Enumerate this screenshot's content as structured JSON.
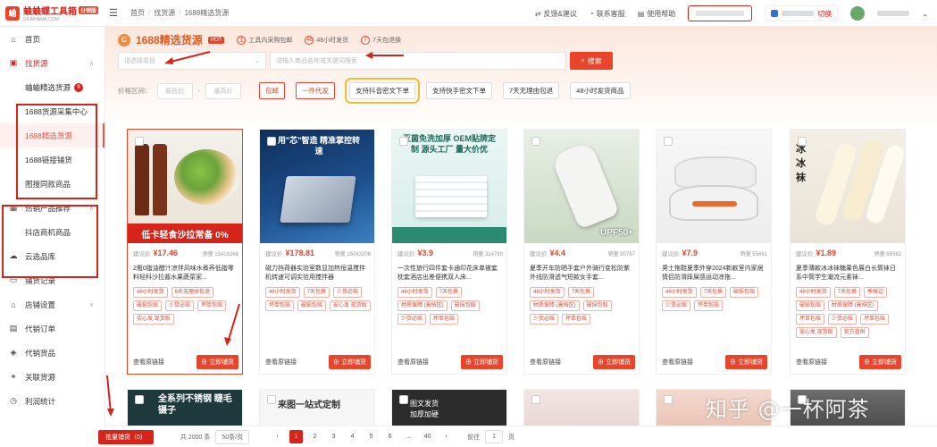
{
  "app": {
    "logo_name": "蛐蛐蝶工具箱",
    "logo_tag": "分销版",
    "logo_url": "SILAIHAMA.COM",
    "logo_badge": "蛐"
  },
  "breadcrumb": [
    "首页",
    "找货源",
    "1688精选货源"
  ],
  "topbar": {
    "feedback": "反馈&建议",
    "contact": "联系客服",
    "help": "使用帮助",
    "switch": "切换"
  },
  "sidebar": {
    "home": "首页",
    "find_source": "找货源",
    "sub_find": [
      "蛐蛐精选货源",
      "1688货源采集中心",
      "1688精选货源",
      "1688链接铺货",
      "图搜同款商品"
    ],
    "sub_find_badge": "9",
    "hot": "热销产品推荐",
    "sub_hot": [
      "抖店商机商品"
    ],
    "cloud": "云选品库",
    "items": [
      "铺货记录",
      "店铺设置",
      "代销订单",
      "代销货品",
      "关联货源",
      "利润统计"
    ]
  },
  "banner": {
    "title": "1688精选货源",
    "hot": "HOT",
    "features": [
      "工具内采购包邮",
      "48小时发货",
      "7天包退换"
    ],
    "feature_icons": [
      "工",
      "48",
      "7"
    ],
    "category_placeholder": "请选择类目",
    "keyword_placeholder": "请输入商品名称或关键词搜索",
    "search_btn": "搜索"
  },
  "filters": {
    "price_label": "价格区间：",
    "min_placeholder": "最低价",
    "max_placeholder": "最高价",
    "dash": "-",
    "chips": [
      "包邮",
      "一件代发",
      "支持抖音密文下单",
      "支持快手密文下单",
      "7天无理由包退",
      "48小时发货商品"
    ]
  },
  "products": [
    {
      "price_label": "建议价",
      "price": "¥17.46",
      "sales": "销量 15416368",
      "title": "2瓶0脂油醋汁凉拌风味水煮荞低脂零料轻科沙拉酱水果蔬菜家...",
      "tags": [
        "48小时发货",
        "8天无理由包退",
        "破损包赔",
        "少货必赔",
        "坏单包赔",
        "实心发 现货版"
      ],
      "img_text": "低卡轻食沙拉常备 0%"
    },
    {
      "price_label": "建议价",
      "price": "¥178.81",
      "sales": "销量 15043206",
      "title": "磁力挡荷器实验室数显加热恒温搅拌机转速可调实验用搅拌器",
      "tags": [
        "48小时发货",
        "7天包换",
        "少货必赔",
        "坏单包赔",
        "破损包赔",
        "安心发 现货版"
      ],
      "img_text": "用\"芯\"智造 精准掌控转速"
    },
    {
      "price_label": "建议价",
      "price": "¥3.9",
      "sales": "销量 314780",
      "title": "一次性旅行四件套卡通印花床单被套枕套酒店出差便携双人床...",
      "tags": [
        "48小时发货",
        "7天包换",
        "材质保障 (高档区)",
        "破损包赔",
        "少货必赔",
        "坏单包赔"
      ],
      "img_text": "灭菌免洗加厚 OEM贴牌定制 源头工厂 量大价优"
    },
    {
      "price_label": "建议价",
      "price": "¥4.4",
      "sales": "销量 90787",
      "title": "夏季开车防晒手套户外骑行变松防紫外线防滑透气短款女手套...",
      "tags": [
        "48小时发货",
        "7天包换",
        "材质保障 (高档区)",
        "破损包赔",
        "少货必赔",
        "坏单包赔"
      ],
      "img_text": "UPF50+"
    },
    {
      "price_label": "建议价",
      "price": "¥7.9",
      "sales": "销量 55661",
      "title": "男士拖鞋夏季外穿2024新款室内家居情侣防滑踩屎感运动凉拖...",
      "tags": [
        "48小时发货",
        "7天包换",
        "破损包赔",
        "少货必赔",
        "坏单包赔"
      ],
      "img_text": ""
    },
    {
      "price_label": "建议价",
      "price": "¥1.89",
      "sales": "销量 66583",
      "title": "夏季薄款冰冰袜糖果色展白长筒袜日系中筒学生潮流元素袜...",
      "tags": [
        "48小时发货",
        "7天包换",
        "季候边",
        "破损包赔",
        "材质保障 (高档区)",
        "坏单包赔",
        "少货必赔",
        "坏单包赔",
        "安心发 现货版",
        "官方直供"
      ],
      "img_text": "冰冰袜"
    }
  ],
  "card_actions": {
    "view": "查看原链接",
    "store": "立即铺货"
  },
  "bottom_cards": [
    "全系列不锈钢 睫毛镊子",
    "来图一站式定制",
    "图文发货 加厚加硬",
    "",
    "",
    ""
  ],
  "pagination": {
    "batch": "批量铺货（0）",
    "total": "共 2000 条",
    "size": "50条/页",
    "pages": [
      "1",
      "2",
      "3",
      "4",
      "5",
      "6",
      "...",
      "40"
    ],
    "goto_label": "前往",
    "goto_value": "1",
    "goto_unit": "页"
  },
  "watermark": "知乎 @一杯阿茶",
  "colors": {
    "brand": "#d7241a",
    "accent": "#e8452c",
    "banner": "#fbe7dc"
  }
}
